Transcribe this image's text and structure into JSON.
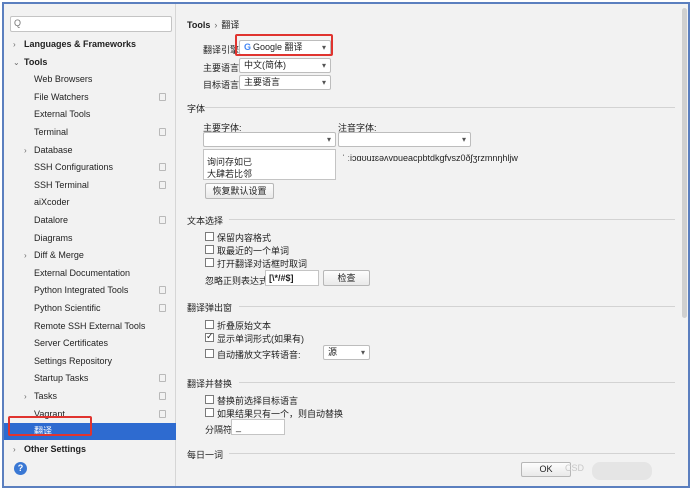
{
  "sidebar": {
    "search_icon": "Q",
    "items": [
      {
        "label": "Languages & Frameworks",
        "arrow": ">",
        "bold": true
      },
      {
        "label": "Tools",
        "arrow": "v",
        "bold": true
      },
      {
        "label": "Web Browsers"
      },
      {
        "label": "File Watchers",
        "project": true
      },
      {
        "label": "External Tools"
      },
      {
        "label": "Terminal",
        "project": true
      },
      {
        "label": "Database",
        "arrow": ">"
      },
      {
        "label": "SSH Configurations",
        "project": true
      },
      {
        "label": "SSH Terminal",
        "project": true
      },
      {
        "label": "aiXcoder"
      },
      {
        "label": "Datalore",
        "project": true
      },
      {
        "label": "Diagrams"
      },
      {
        "label": "Diff & Merge",
        "arrow": ">"
      },
      {
        "label": "External Documentation"
      },
      {
        "label": "Python Integrated Tools",
        "project": true
      },
      {
        "label": "Python Scientific",
        "project": true
      },
      {
        "label": "Remote SSH External Tools"
      },
      {
        "label": "Server Certificates"
      },
      {
        "label": "Settings Repository"
      },
      {
        "label": "Startup Tasks",
        "project": true
      },
      {
        "label": "Tasks",
        "arrow": ">",
        "project": true
      },
      {
        "label": "Vagrant",
        "project": true
      },
      {
        "label": "翻译",
        "selected": true
      },
      {
        "label": "Other Settings",
        "arrow": ">",
        "bold": true
      }
    ],
    "help_label": "?"
  },
  "breadcrumb": {
    "root": "Tools",
    "separator": "›",
    "current": "翻译"
  },
  "engine": {
    "label": "翻译引擎:",
    "logo": "G",
    "value": "Google 翻译",
    "primary_label": "主要语言:",
    "primary_value": "中文(简体)",
    "target_label": "目标语言:",
    "target_value": "主要语言"
  },
  "font": {
    "section": "字体",
    "primary_label": "主要字体:",
    "phonetic_label": "注音字体:",
    "preview_line1": "询问存如已",
    "preview_line2": "大肆若比邻",
    "phonetic_preview": "ˈ ːiɔɑʊuɪɛəʌvɒueacpbtdkgfvsz0ðʃʒrzmnŋhljw",
    "reset_button": "恢复默认设置"
  },
  "text_selection": {
    "section": "文本选择",
    "opt1": "保留内容格式",
    "opt2": "取最近的一个单词",
    "opt3": "打开翻译对话框时取词",
    "regex_label": "忽略正则表达式:",
    "regex_value": "[\\*/#$]",
    "check_button": "检查"
  },
  "popup": {
    "section": "翻译弹出窗",
    "opt1": "折叠原始文本",
    "opt2": "显示单词形式(如果有)",
    "opt3": "自动播放文字转语音:",
    "tts_value": "源"
  },
  "replace": {
    "section": "翻译并替换",
    "opt1": "替换前选择目标语言",
    "opt2": "如果结果只有一个，则自动替换",
    "sep_label": "分隔符:",
    "sep_value": "_"
  },
  "daily": {
    "section": "每日一词"
  },
  "footer": {
    "ok_button": "OK",
    "watermark": "CSD"
  }
}
